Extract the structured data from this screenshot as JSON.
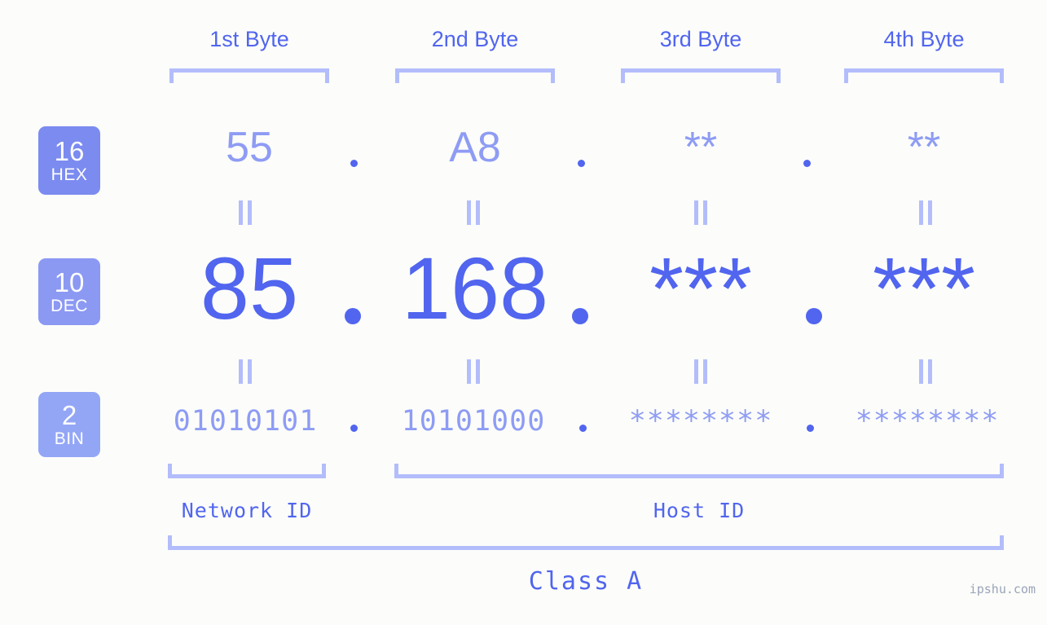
{
  "meta": {
    "background_color": "#fcfdfa",
    "accent_strong": "#5165ef",
    "accent_mid": "#8e9cf4",
    "accent_light": "#b3bdfb"
  },
  "byte_headers": [
    {
      "label": "1st Byte"
    },
    {
      "label": "2nd Byte"
    },
    {
      "label": "3rd Byte"
    },
    {
      "label": "4th Byte"
    }
  ],
  "rows": {
    "hex": {
      "badge_number": "16",
      "badge_name": "HEX",
      "badge_color": "#7b8bf0",
      "values": [
        "55",
        "A8",
        "**",
        "**"
      ],
      "separator": "."
    },
    "dec": {
      "badge_number": "10",
      "badge_name": "DEC",
      "badge_color": "#8b99f3",
      "values": [
        "85",
        "168",
        "***",
        "***"
      ],
      "separator": "."
    },
    "bin": {
      "badge_number": "2",
      "badge_name": "BIN",
      "badge_color": "#93a6f6",
      "values": [
        "01010101",
        "10101000",
        "********",
        "********"
      ],
      "separator": "."
    }
  },
  "equals_marks": {
    "symbol": "||",
    "count_per_row": 4
  },
  "id_sections": [
    {
      "label": "Network ID"
    },
    {
      "label": "Host ID"
    }
  ],
  "class_section": {
    "label": "Class A"
  },
  "watermark": {
    "text": "ipshu.com"
  }
}
